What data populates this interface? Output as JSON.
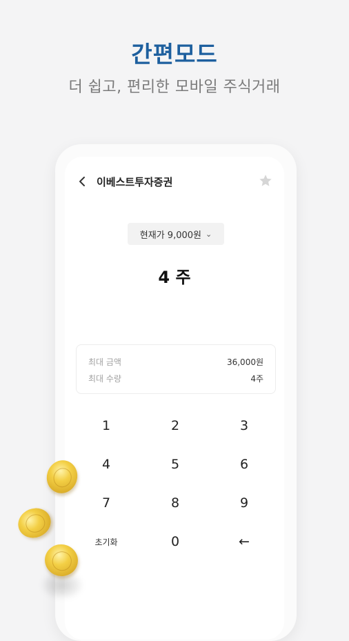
{
  "hero": {
    "title": "간편모드",
    "subtitle": "더 쉽고, 편리한 모바일 주식거래"
  },
  "header": {
    "back_icon": "chevron-left-icon",
    "stock_name": "이베스트투자증권",
    "favorite_icon": "star-icon"
  },
  "price_selector": {
    "label": "현재가 9,000원",
    "chevron": "⌄"
  },
  "order": {
    "quantity": "4 주"
  },
  "info": {
    "max_amount_label": "최대 금액",
    "max_amount_value": "36,000원",
    "max_qty_label": "최대 수량",
    "max_qty_value": "4주"
  },
  "keypad": {
    "keys": [
      "1",
      "2",
      "3",
      "4",
      "5",
      "6",
      "7",
      "8",
      "9",
      "초기화",
      "0",
      "←"
    ]
  },
  "colors": {
    "accent": "#1d5f9e",
    "coin": "#f3cf45"
  }
}
